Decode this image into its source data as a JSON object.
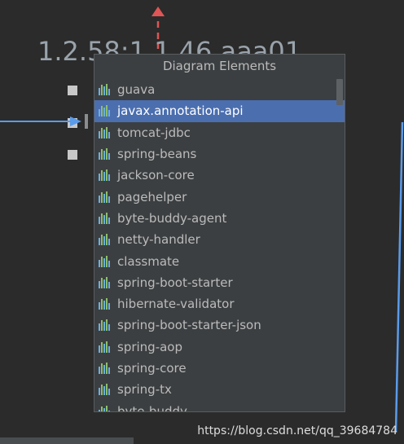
{
  "diagram": {
    "version_label": "1.2.58:1.1.46.aaa01"
  },
  "popup": {
    "title": "Diagram Elements",
    "selected_index": 1,
    "items": [
      {
        "label": "guava"
      },
      {
        "label": "javax.annotation-api"
      },
      {
        "label": "tomcat-jdbc"
      },
      {
        "label": "spring-beans"
      },
      {
        "label": "jackson-core"
      },
      {
        "label": "pagehelper"
      },
      {
        "label": "byte-buddy-agent"
      },
      {
        "label": "netty-handler"
      },
      {
        "label": "classmate"
      },
      {
        "label": "spring-boot-starter"
      },
      {
        "label": "hibernate-validator"
      },
      {
        "label": "spring-boot-starter-json"
      },
      {
        "label": "spring-aop"
      },
      {
        "label": "spring-core"
      },
      {
        "label": "spring-tx"
      },
      {
        "label": "byte-buddy"
      }
    ],
    "item_icon": "library-bars-icon"
  },
  "watermark": {
    "text": "https://blog.csdn.net/qq_39684784"
  },
  "colors": {
    "background": "#2b2b2b",
    "popup_bg": "#3c3f41",
    "selection": "#4b6eaf",
    "edge_blue": "#5a9bea",
    "arrow_red": "#e05555"
  }
}
